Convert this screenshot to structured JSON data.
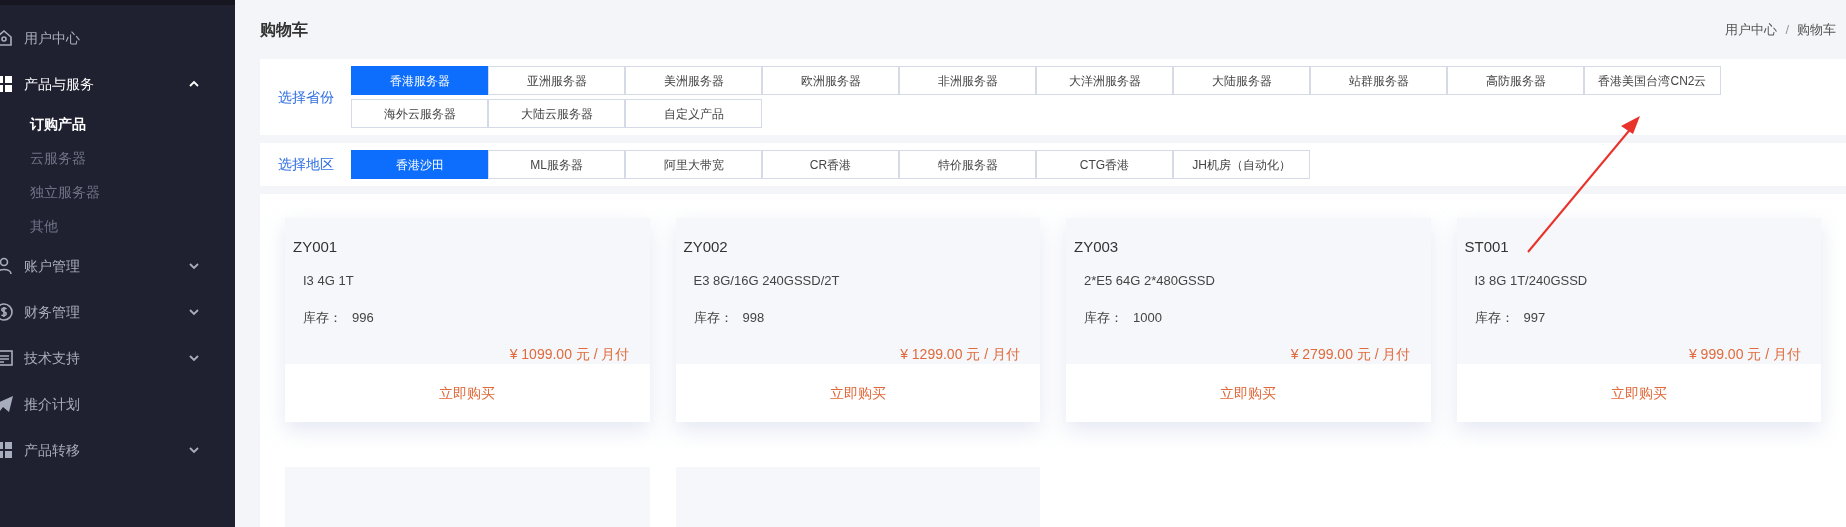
{
  "sidebar": {
    "items": [
      {
        "label": "用户中心",
        "kind": "link"
      },
      {
        "label": "产品与服务",
        "kind": "group",
        "expanded": true,
        "children": [
          {
            "label": "订购产品",
            "selected": true
          },
          {
            "label": "云服务器",
            "selected": false
          },
          {
            "label": "独立服务器",
            "selected": false
          },
          {
            "label": "其他",
            "selected": false
          }
        ]
      },
      {
        "label": "账户管理",
        "kind": "group",
        "expanded": false
      },
      {
        "label": "财务管理",
        "kind": "group",
        "expanded": false
      },
      {
        "label": "技术支持",
        "kind": "group",
        "expanded": false
      },
      {
        "label": "推介计划",
        "kind": "link"
      },
      {
        "label": "产品转移",
        "kind": "group",
        "expanded": false
      }
    ]
  },
  "page_title": "购物车",
  "breadcrumb": {
    "items": [
      "用户中心",
      "购物车"
    ],
    "separator": "/"
  },
  "filters": [
    {
      "label": "选择省份",
      "options": [
        {
          "label": "香港服务器",
          "selected": true
        },
        {
          "label": "亚洲服务器",
          "selected": false
        },
        {
          "label": "美洲服务器",
          "selected": false
        },
        {
          "label": "欧洲服务器",
          "selected": false
        },
        {
          "label": "非洲服务器",
          "selected": false
        },
        {
          "label": "大洋洲服务器",
          "selected": false
        },
        {
          "label": "大陆服务器",
          "selected": false
        },
        {
          "label": "站群服务器",
          "selected": false
        },
        {
          "label": "高防服务器",
          "selected": false
        },
        {
          "label": "香港美国台湾CN2云",
          "selected": false
        },
        {
          "label": "海外云服务器",
          "selected": false
        },
        {
          "label": "大陆云服务器",
          "selected": false
        },
        {
          "label": "自定义产品",
          "selected": false
        }
      ]
    },
    {
      "label": "选择地区",
      "options": [
        {
          "label": "香港沙田",
          "selected": true
        },
        {
          "label": "ML服务器",
          "selected": false
        },
        {
          "label": "阿里大带宽",
          "selected": false
        },
        {
          "label": "CR香港",
          "selected": false
        },
        {
          "label": "特价服务器",
          "selected": false
        },
        {
          "label": "CTG香港",
          "selected": false
        },
        {
          "label": "JH机房（自动化）",
          "selected": false
        }
      ]
    }
  ],
  "products": [
    {
      "kind": "product",
      "name": "ZY001",
      "spec": "I3 4G 1T",
      "stock_label": "库存：",
      "stock": "996",
      "price": "¥ 1099.00 元 / 月付",
      "button": "立即购买"
    },
    {
      "kind": "product",
      "name": "ZY002",
      "spec": "E3 8G/16G 240GSSD/2T",
      "stock_label": "库存：",
      "stock": "998",
      "price": "¥ 1299.00 元 / 月付",
      "button": "立即购买"
    },
    {
      "kind": "product",
      "name": "ZY003",
      "spec": "2*E5 64G 2*480GSSD",
      "stock_label": "库存：",
      "stock": "1000",
      "price": "¥ 2799.00 元 / 月付",
      "button": "立即购买"
    },
    {
      "kind": "product",
      "name": "ST001",
      "spec": "I3 8G 1T/240GSSD",
      "stock_label": "库存：",
      "stock": "997",
      "price": "¥ 999.00 元 / 月付",
      "button": "立即购买"
    },
    {
      "kind": "partial"
    },
    {
      "kind": "partial"
    }
  ]
}
